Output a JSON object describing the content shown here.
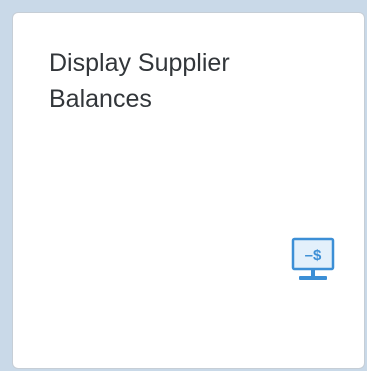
{
  "tile": {
    "title_line1": "Display Supplier",
    "title_line2": "Balances",
    "icon_name": "display-balance-dollar-icon",
    "icon_glyph": "–$",
    "accent_color": "#3c8fd6",
    "icon_screen_fill": "#e3f0fb"
  }
}
